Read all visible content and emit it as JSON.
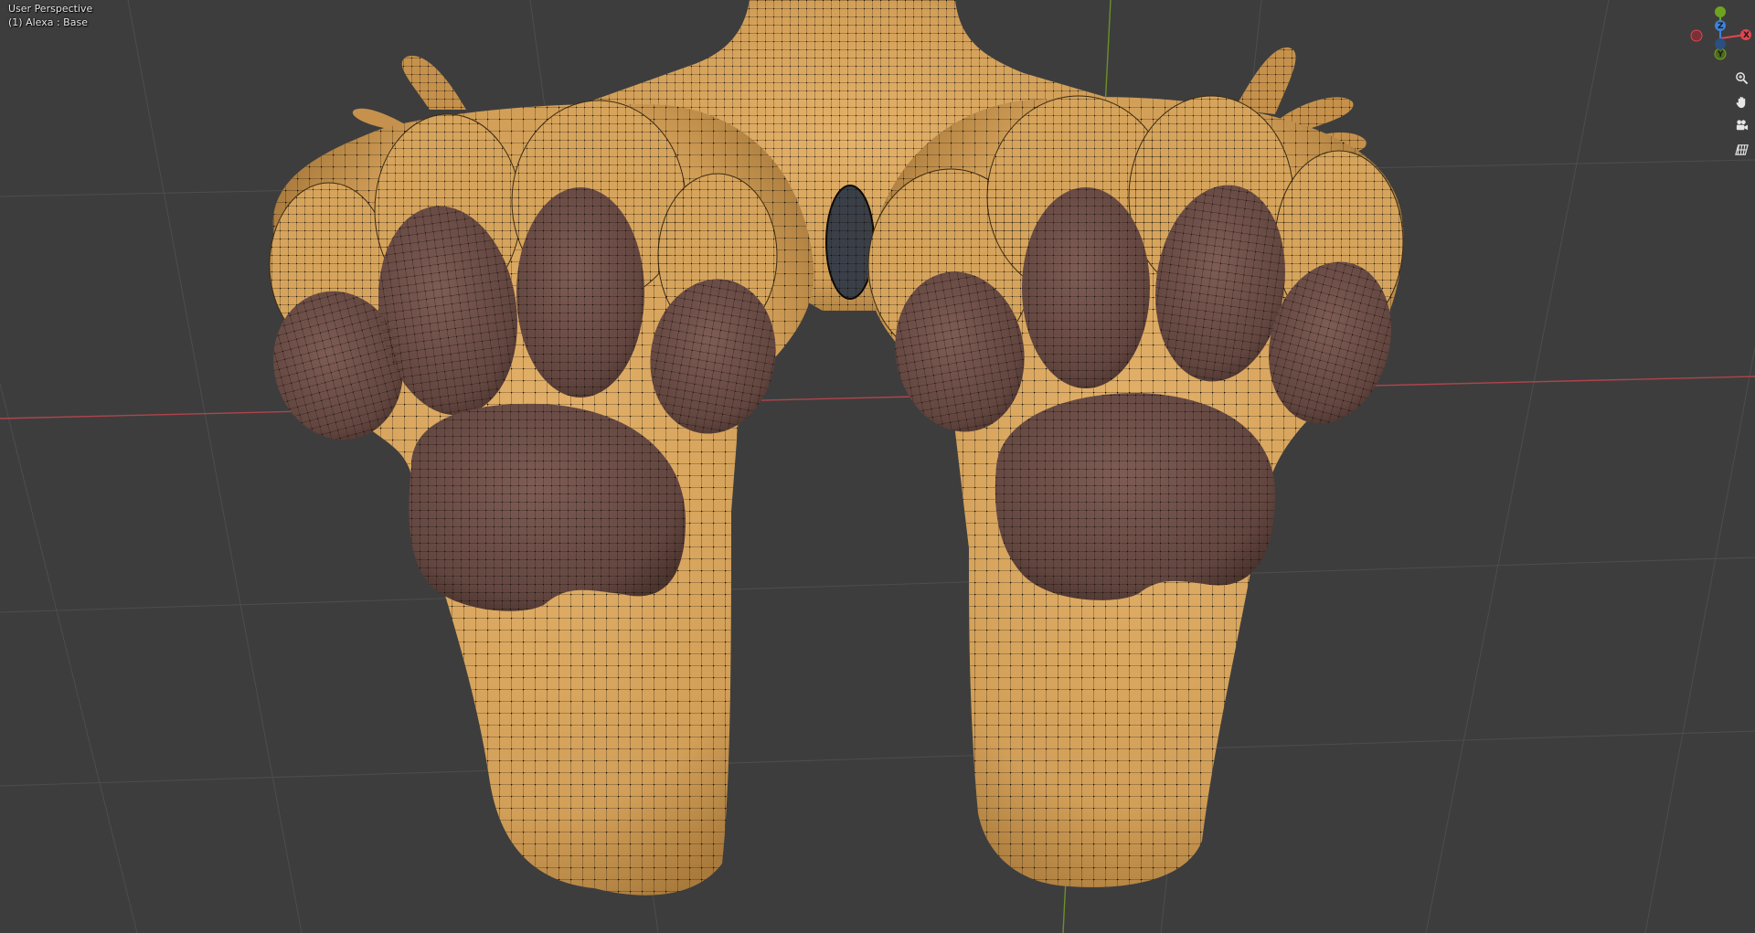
{
  "viewport": {
    "view_name": "User Perspective",
    "object_info": "(1) Alexa : Base"
  },
  "gizmo": {
    "axes": [
      {
        "label": "X",
        "color": "#e0464f"
      },
      {
        "label": "Y",
        "color": "#6fa31f"
      },
      {
        "label": "Z",
        "color": "#3f82d8"
      }
    ]
  },
  "nav_tools": [
    {
      "name": "zoom-icon"
    },
    {
      "name": "pan-hand-icon"
    },
    {
      "name": "camera-icon"
    },
    {
      "name": "ortho-grid-icon"
    }
  ],
  "colors": {
    "background": "#3d3d3d",
    "fur": "#d8a55b",
    "pad": "#6e4f4a",
    "wire": "#1a1308",
    "x_axis": "#b0444c",
    "y_axis": "#6b8f2a"
  }
}
